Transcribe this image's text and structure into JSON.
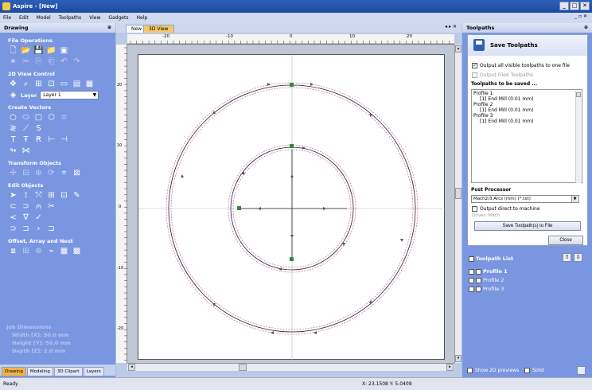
{
  "titlebar": {
    "title": "Aspire - [New]"
  },
  "menu": [
    "File",
    "Edit",
    "Model",
    "Toolpaths",
    "View",
    "Gadgets",
    "Help"
  ],
  "left_panel": {
    "header": "Drawing",
    "sections": {
      "file_ops": "File Operations",
      "view_control": "2D View Control",
      "create_vectors": "Create Vectors",
      "transform": "Transform Objects",
      "edit": "Edit Objects",
      "offset": "Offset, Array and Nest"
    },
    "layer_label": "Layer",
    "layer_value": "Layer 1",
    "job": {
      "title": "Job Dimensions",
      "width": "Width  [X]: 50.0 mm",
      "height": "Height [Y]: 50.0 mm",
      "depth": "Depth  [Z]: 2.0 mm"
    },
    "tabs": [
      "Drawing",
      "Modeling",
      "3D Clipart",
      "Layers"
    ]
  },
  "doc_tabs": [
    "New",
    "3D View"
  ],
  "ruler": {
    "h": [
      "-20",
      "-10",
      "0",
      "10",
      "20"
    ],
    "v": [
      "20",
      "10",
      "0",
      "-10",
      "-20"
    ]
  },
  "right_panel": {
    "header": "Toolpaths",
    "save_title": "Save Toolpaths",
    "opt_all": "Output all visible toolpaths to one file",
    "opt_filed": "Output Filed Toolpaths",
    "to_save_label": "Toolpaths to be saved ...",
    "list": [
      {
        "name": "Profile 1",
        "tool": "[1] End Mill (0.01 mm)"
      },
      {
        "name": "Profile 2",
        "tool": "[1] End Mill (0.01 mm)"
      },
      {
        "name": "Profile 3",
        "tool": "[1] End Mill (0.01 mm)"
      }
    ],
    "pp_label": "Post Processor",
    "pp_value": "Mach2/3 Arcs (mm) (*.txt)",
    "opt_direct": "Output direct to machine",
    "driver": "Driver: Mach",
    "save_button": "Save Toolpath(s) to File",
    "close_button": "Close",
    "tp_list_label": "Toolpath List",
    "tp_items": [
      "Profile 1",
      "Profile 2",
      "Profile 3"
    ],
    "show_2d": "Show 2D previews",
    "solid": "Solid"
  },
  "status": {
    "left": "Ready",
    "coords": "X: 23.1508 Y: 5.0409"
  },
  "colors": {
    "panel": "#7a96e0",
    "title": "#1e4aa0",
    "toolpath": "#c050a0",
    "vector": "#222222"
  }
}
